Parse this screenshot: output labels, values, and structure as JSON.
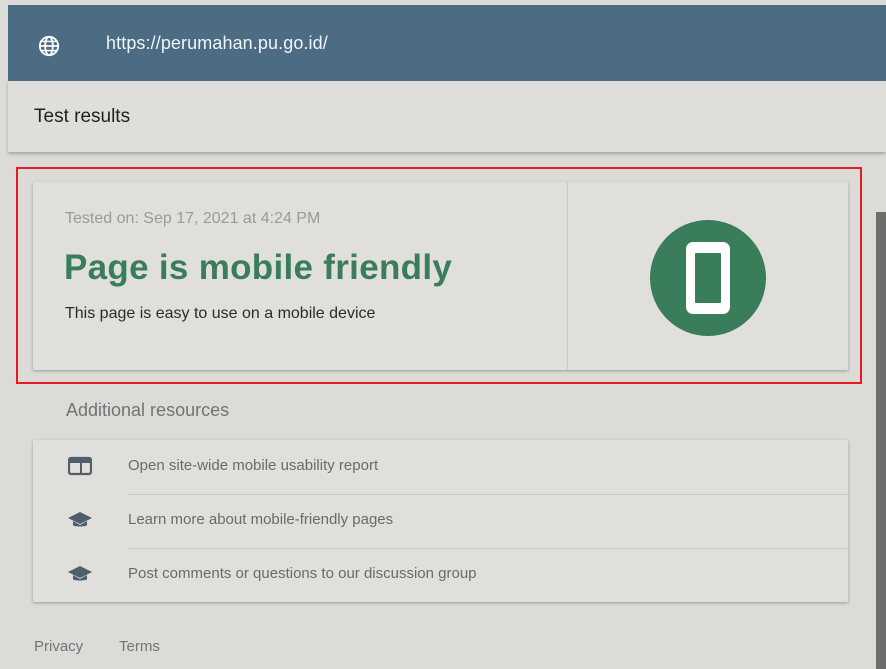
{
  "urlbar": {
    "icon": "globe-icon",
    "url": "https://perumahan.pu.go.id/"
  },
  "header": {
    "title": "Test results"
  },
  "result": {
    "tested_on": "Tested on: Sep 17, 2021 at 4:24 PM",
    "title": "Page is mobile friendly",
    "description": "This page is easy to use on a mobile device",
    "icon": "mobile-phone-icon",
    "accent_color": "#3a7d5a"
  },
  "resources": {
    "title": "Additional resources",
    "items": [
      {
        "icon": "report-icon",
        "label": "Open site-wide mobile usability report"
      },
      {
        "icon": "graduation-cap-icon",
        "label": "Learn more about mobile-friendly pages"
      },
      {
        "icon": "graduation-cap-icon",
        "label": "Post comments or questions to our discussion group"
      }
    ]
  },
  "footer": {
    "privacy": "Privacy",
    "terms": "Terms"
  },
  "colors": {
    "urlbar_bg": "#4b6c82",
    "highlight_border": "#e31b23"
  }
}
